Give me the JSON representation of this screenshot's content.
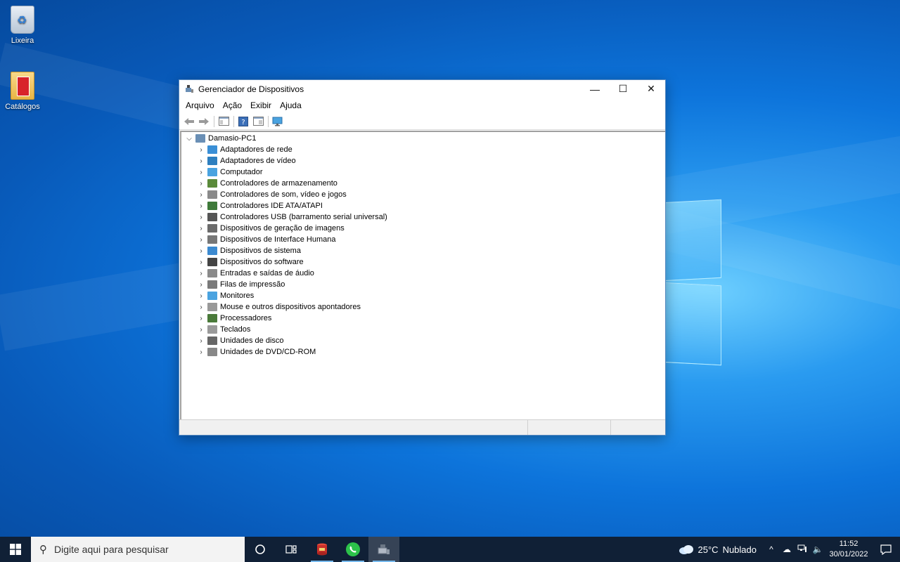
{
  "desktop": {
    "icons": [
      {
        "label": "Lixeira"
      },
      {
        "label": "Catálogos"
      }
    ]
  },
  "window": {
    "title": "Gerenciador de Dispositivos",
    "menu": [
      "Arquivo",
      "Ação",
      "Exibir",
      "Ajuda"
    ],
    "controls": {
      "minimize": "—",
      "maximize": "☐",
      "close": "✕"
    },
    "tree": {
      "root": "Damasio-PC1",
      "items": [
        {
          "label": "Adaptadores de rede",
          "icon": "network-adapter-icon",
          "color": "#3a8fd6"
        },
        {
          "label": "Adaptadores de vídeo",
          "icon": "display-adapter-icon",
          "color": "#2e7fbf"
        },
        {
          "label": "Computador",
          "icon": "computer-icon",
          "color": "#4aa3e0"
        },
        {
          "label": "Controladores de armazenamento",
          "icon": "storage-controller-icon",
          "color": "#5a8a3a"
        },
        {
          "label": "Controladores de som, vídeo e jogos",
          "icon": "sound-icon",
          "color": "#8a8a8a"
        },
        {
          "label": "Controladores IDE ATA/ATAPI",
          "icon": "ide-controller-icon",
          "color": "#3f7a3a"
        },
        {
          "label": "Controladores USB (barramento serial universal)",
          "icon": "usb-icon",
          "color": "#555555"
        },
        {
          "label": "Dispositivos de geração de imagens",
          "icon": "camera-icon",
          "color": "#6b6b6b"
        },
        {
          "label": "Dispositivos de Interface Humana",
          "icon": "hid-icon",
          "color": "#777777"
        },
        {
          "label": "Dispositivos de sistema",
          "icon": "system-device-icon",
          "color": "#3c8ad0"
        },
        {
          "label": "Dispositivos do software",
          "icon": "software-device-icon",
          "color": "#444444"
        },
        {
          "label": "Entradas e saídas de áudio",
          "icon": "audio-io-icon",
          "color": "#8a8a8a"
        },
        {
          "label": "Filas de impressão",
          "icon": "printer-icon",
          "color": "#7a7a7a"
        },
        {
          "label": "Monitores",
          "icon": "monitor-icon",
          "color": "#4aa3e0"
        },
        {
          "label": "Mouse e outros dispositivos apontadores",
          "icon": "mouse-icon",
          "color": "#999999"
        },
        {
          "label": "Processadores",
          "icon": "processor-icon",
          "color": "#4a7a3a"
        },
        {
          "label": "Teclados",
          "icon": "keyboard-icon",
          "color": "#9a9a9a"
        },
        {
          "label": "Unidades de disco",
          "icon": "disk-drive-icon",
          "color": "#666666"
        },
        {
          "label": "Unidades de DVD/CD-ROM",
          "icon": "dvd-drive-icon",
          "color": "#888888"
        }
      ]
    }
  },
  "taskbar": {
    "search_placeholder": "Digite aqui para pesquisar",
    "weather": {
      "temp": "25°C",
      "condition": "Nublado"
    },
    "clock": {
      "time": "11:52",
      "date": "30/01/2022"
    }
  }
}
